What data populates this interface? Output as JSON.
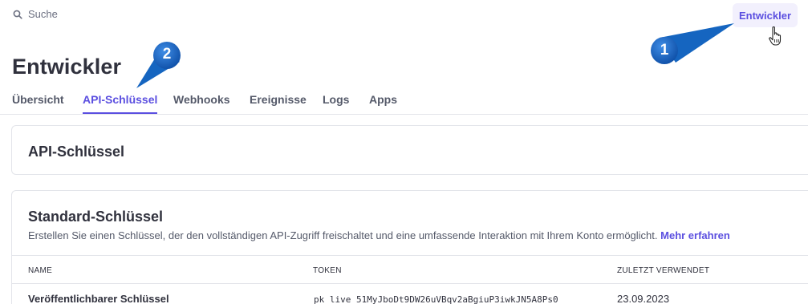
{
  "search": {
    "label": "Suche"
  },
  "header": {
    "dev_button_label": "Entwickler"
  },
  "callouts": [
    {
      "number": "1"
    },
    {
      "number": "2"
    }
  ],
  "page": {
    "title": "Entwickler"
  },
  "tabs": [
    {
      "label": "Übersicht"
    },
    {
      "label": "API-Schlüssel"
    },
    {
      "label": "Webhooks"
    },
    {
      "label": "Ereignisse"
    },
    {
      "label": "Logs"
    },
    {
      "label": "Apps"
    }
  ],
  "active_tab": "API-Schlüssel",
  "api_card": {
    "title": "API-Schlüssel"
  },
  "standard_card": {
    "title": "Standard-Schlüssel",
    "description": "Erstellen Sie einen Schlüssel, der den vollständigen API-Zugriff freischaltet und eine umfassende Interaktion mit Ihrem Konto ermöglicht.",
    "link": "Mehr erfahren",
    "columns": [
      "NAME",
      "TOKEN",
      "ZULETZT VERWENDET"
    ],
    "rows": [
      {
        "name": "Veröffentlichbarer Schlüssel",
        "token": "pk_live_51MyJboDt9DW26uVBqv2aBgiuP3iwkJN5A8Ps0",
        "last_used": "23.09.2023"
      }
    ]
  },
  "colors": {
    "accent": "#5b4fe0",
    "callout": "#1565c0",
    "text": "#30313d",
    "muted": "#545969"
  },
  "icons": {
    "search": "search-icon",
    "cursor": "hand-pointer-icon"
  }
}
